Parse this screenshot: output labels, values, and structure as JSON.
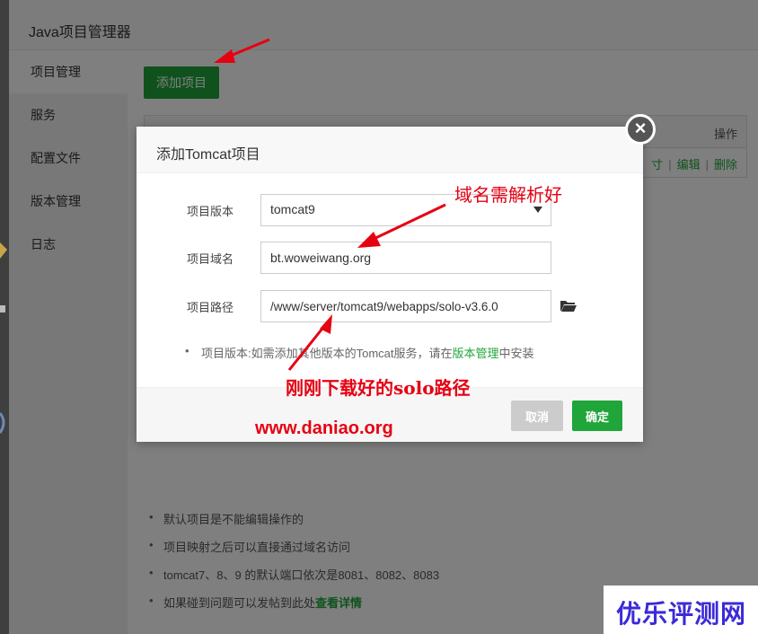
{
  "window": {
    "title": "Java项目管理器"
  },
  "sidebar": {
    "items": [
      {
        "label": "项目管理",
        "active": true
      },
      {
        "label": "服务",
        "active": false
      },
      {
        "label": "配置文件",
        "active": false
      },
      {
        "label": "版本管理",
        "active": false
      },
      {
        "label": "日志",
        "active": false
      }
    ]
  },
  "main": {
    "add_button": "添加项目",
    "table": {
      "header_action": "操作",
      "row_actions": {
        "partial": "寸",
        "edit": "编辑",
        "delete": "删除",
        "sep": "|"
      }
    },
    "notes": [
      {
        "text": "默认项目是不能编辑操作的"
      },
      {
        "text": "项目映射之后可以直接通过域名访问"
      },
      {
        "text": "tomcat7、8、9 的默认端口依次是8081、8082、8083"
      },
      {
        "text": "如果碰到问题可以发帖到此处",
        "link": "查看详情"
      }
    ]
  },
  "dialog": {
    "title": "添加Tomcat项目",
    "close": "×",
    "fields": {
      "version": {
        "label": "项目版本",
        "value": "tomcat9"
      },
      "domain": {
        "label": "项目域名",
        "value": "bt.woweiwang.org"
      },
      "path": {
        "label": "项目路径",
        "value": "/www/server/tomcat9/webapps/solo-v3.6.0"
      }
    },
    "hint": {
      "prefix": "项目版本:如需添加其他版本的Tomcat服务，请在",
      "link": "版本管理",
      "suffix": "中安装"
    },
    "cancel": "取消",
    "confirm": "确定"
  },
  "annotations": {
    "domain_note": "域名需解析好",
    "path_note": "刚刚下载好的solo路径",
    "site": "www.daniao.org"
  },
  "watermark": "优乐评测网",
  "colors": {
    "accent": "#20a53a",
    "annotation": "#e60012",
    "watermark": "#3b2bd8"
  }
}
